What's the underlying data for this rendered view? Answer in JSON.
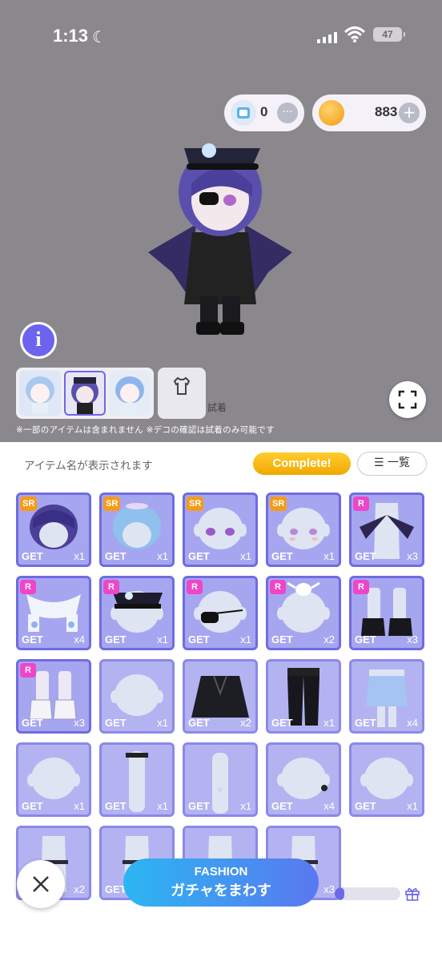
{
  "status": {
    "time": "1:13",
    "battery": "47"
  },
  "currency": {
    "ticket_value": "0",
    "coin_value": "883"
  },
  "tryon_label": "試着",
  "notice": "※一部のアイテムは含まれません ※デコの確認は試着のみ可能です",
  "panel": {
    "hint": "アイテム名が表示されます",
    "complete_label": "Complete!",
    "list_label": "一覧"
  },
  "items": [
    {
      "rarity": "SR",
      "get": "GET",
      "count": "x1",
      "kind": "hair"
    },
    {
      "rarity": "SR",
      "get": "GET",
      "count": "x1",
      "kind": "hair-blue"
    },
    {
      "rarity": "SR",
      "get": "GET",
      "count": "x1",
      "kind": "eyes"
    },
    {
      "rarity": "SR",
      "get": "GET",
      "count": "x1",
      "kind": "face"
    },
    {
      "rarity": "R",
      "get": "GET",
      "count": "x3",
      "kind": "wings"
    },
    {
      "rarity": "R",
      "get": "GET",
      "count": "x4",
      "kind": "scarf"
    },
    {
      "rarity": "R",
      "get": "GET",
      "count": "x1",
      "kind": "hat"
    },
    {
      "rarity": "R",
      "get": "GET",
      "count": "x1",
      "kind": "eyepatch"
    },
    {
      "rarity": "R",
      "get": "GET",
      "count": "x2",
      "kind": "halo"
    },
    {
      "rarity": "R",
      "get": "GET",
      "count": "x3",
      "kind": "boots"
    },
    {
      "rarity": "R",
      "get": "GET",
      "count": "x3",
      "kind": "boots-white"
    },
    {
      "rarity": "",
      "get": "GET",
      "count": "x1",
      "kind": "head"
    },
    {
      "rarity": "",
      "get": "GET",
      "count": "x2",
      "kind": "jacket"
    },
    {
      "rarity": "",
      "get": "GET",
      "count": "x1",
      "kind": "pants"
    },
    {
      "rarity": "",
      "get": "GET",
      "count": "x4",
      "kind": "shorts"
    },
    {
      "rarity": "",
      "get": "GET",
      "count": "x1",
      "kind": "head"
    },
    {
      "rarity": "",
      "get": "GET",
      "count": "x1",
      "kind": "neck"
    },
    {
      "rarity": "",
      "get": "GET",
      "count": "x1",
      "kind": "arm"
    },
    {
      "rarity": "",
      "get": "GET",
      "count": "x4",
      "kind": "head-ear"
    },
    {
      "rarity": "",
      "get": "GET",
      "count": "x1",
      "kind": "head"
    },
    {
      "rarity": "",
      "get": "GET",
      "count": "x2",
      "kind": "leg"
    },
    {
      "rarity": "",
      "get": "GET",
      "count": "",
      "kind": "leg"
    },
    {
      "rarity": "",
      "get": "",
      "count": "",
      "kind": "leg"
    },
    {
      "rarity": "",
      "get": "",
      "count": "x3",
      "kind": "leg"
    }
  ],
  "gacha": {
    "line1": "FASHION",
    "line2": "ガチャをまわす",
    "progress": 0.15
  },
  "colors": {
    "accent": "#6c68e8",
    "coin": "#f5a623",
    "complete": "#f7b500"
  }
}
